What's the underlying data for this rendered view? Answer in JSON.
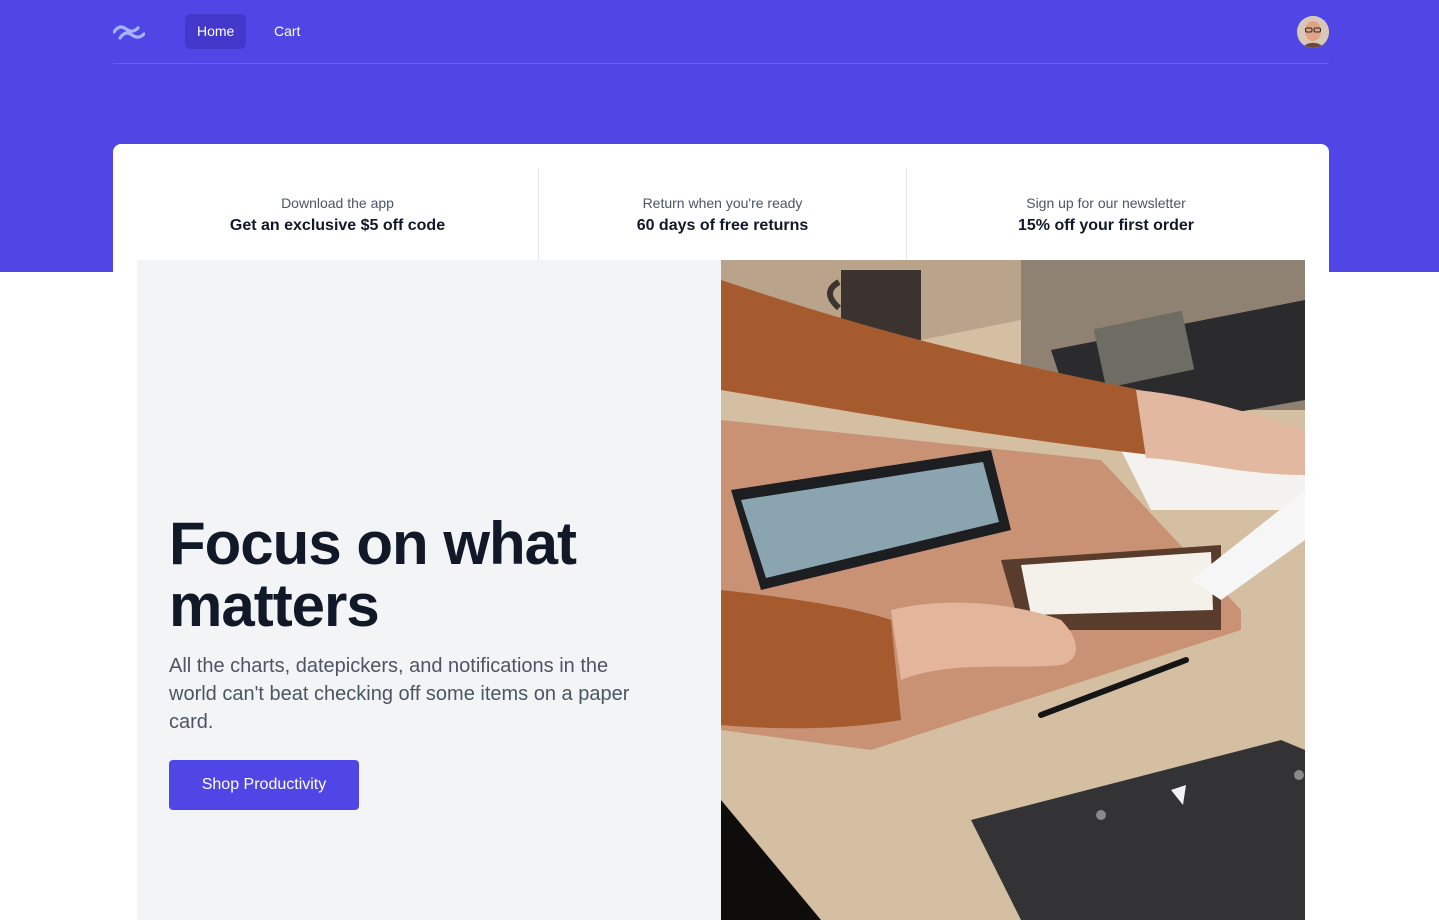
{
  "nav": {
    "logo_icon": "tailwind-wave-logo-icon",
    "links": [
      {
        "label": "Home",
        "active": true
      },
      {
        "label": "Cart",
        "active": false
      }
    ],
    "avatar_icon": "user-avatar"
  },
  "perks": [
    {
      "subtitle": "Download the app",
      "title": "Get an exclusive $5 off code"
    },
    {
      "subtitle": "Return when you're ready",
      "title": "60 days of free returns"
    },
    {
      "subtitle": "Sign up for our newsletter",
      "title": "15% off your first order"
    }
  ],
  "hero": {
    "title": "Focus on what matters",
    "description": "All the charts, datepickers, and notifications in the world can't beat checking off some items on a paper card.",
    "cta_label": "Shop Productivity"
  },
  "colors": {
    "brand": "#4f46e5",
    "brand_dark": "#4338ca",
    "hero_panel": "#f3f4f6",
    "heading": "#111827",
    "body_text": "#4b5563"
  }
}
